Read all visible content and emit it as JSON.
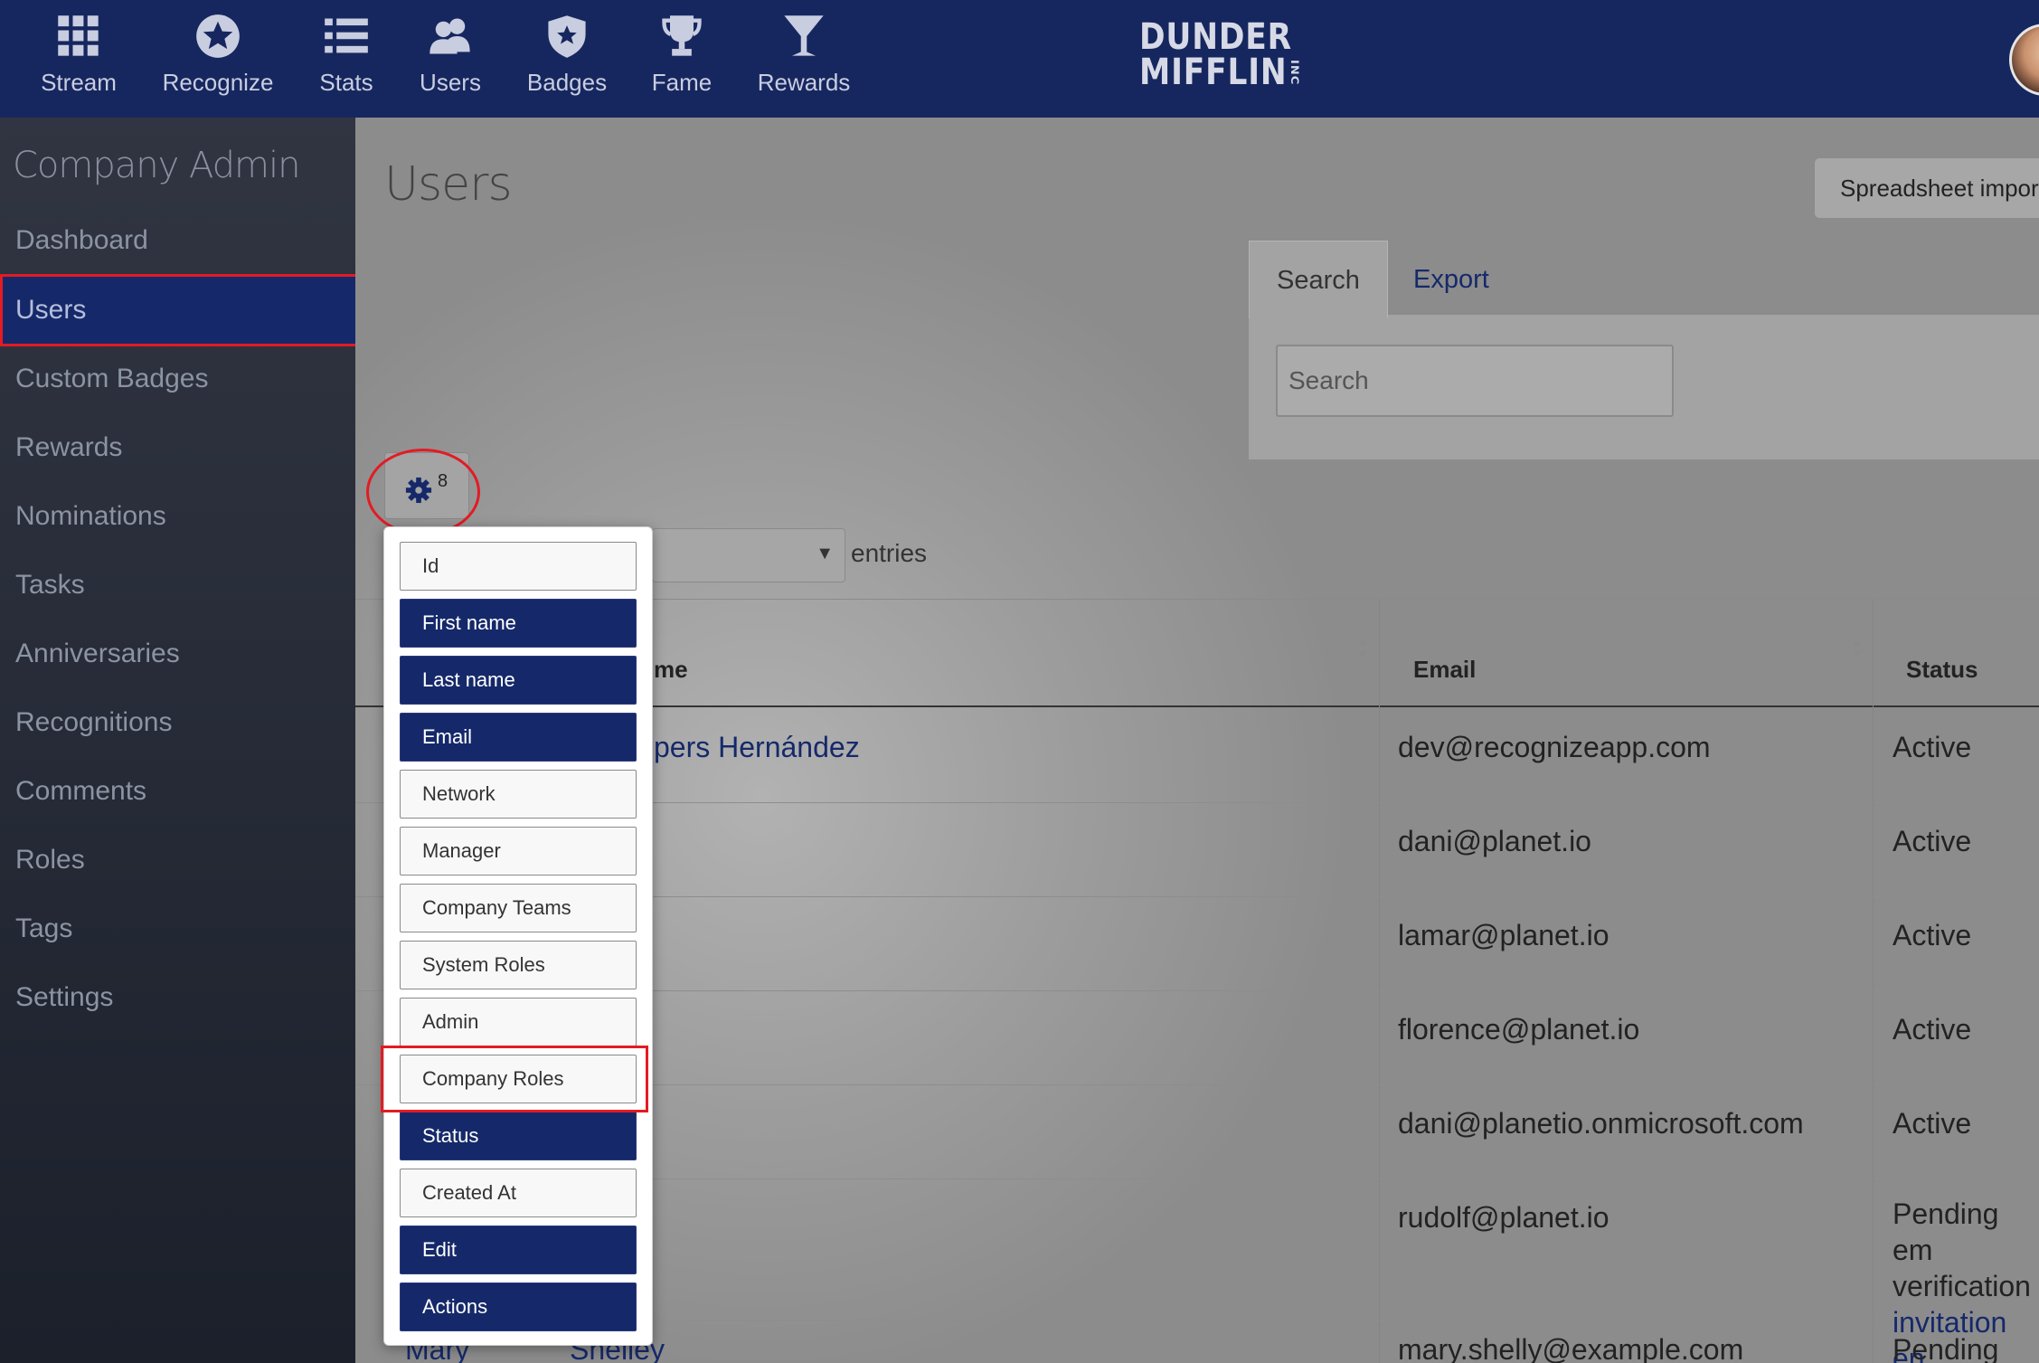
{
  "nav": {
    "items": [
      {
        "label": "Stream",
        "icon": "grid-icon"
      },
      {
        "label": "Recognize",
        "icon": "star-icon"
      },
      {
        "label": "Stats",
        "icon": "list-icon"
      },
      {
        "label": "Users",
        "icon": "users-icon"
      },
      {
        "label": "Badges",
        "icon": "shield-icon"
      },
      {
        "label": "Fame",
        "icon": "trophy-icon"
      },
      {
        "label": "Rewards",
        "icon": "cocktail-icon"
      }
    ],
    "logo_line1": "DUNDER",
    "logo_line2": "MIFFLIN",
    "logo_suffix": "INC"
  },
  "sidebar": {
    "title": "Company Admin",
    "items": [
      {
        "label": "Dashboard"
      },
      {
        "label": "Users",
        "active": true
      },
      {
        "label": "Custom Badges"
      },
      {
        "label": "Rewards"
      },
      {
        "label": "Nominations"
      },
      {
        "label": "Tasks"
      },
      {
        "label": "Anniversaries"
      },
      {
        "label": "Recognitions"
      },
      {
        "label": "Comments"
      },
      {
        "label": "Roles"
      },
      {
        "label": "Tags"
      },
      {
        "label": "Settings"
      }
    ]
  },
  "main": {
    "title": "Users",
    "spreadsheet_button": "Spreadsheet import",
    "tabs": {
      "search": "Search",
      "export": "Export"
    },
    "search_placeholder": "Search",
    "column_toggle_count": "8",
    "entries_label": "entries"
  },
  "table": {
    "headers": {
      "name": "me",
      "email": "Email",
      "status": "Status"
    },
    "rows": [
      {
        "name": "pers Hernández",
        "email": "dev@recognizeapp.com",
        "status": "Active"
      },
      {
        "name": "",
        "email": "dani@planet.io",
        "status": "Active"
      },
      {
        "name": "",
        "email": "lamar@planet.io",
        "status": "Active"
      },
      {
        "name": "",
        "email": "florence@planet.io",
        "status": "Active"
      },
      {
        "name": "",
        "email": "dani@planetio.onmicrosoft.com",
        "status": "Active"
      },
      {
        "name": "",
        "email": "rudolf@planet.io",
        "status_line1": "Pending em",
        "status_line2": "verification",
        "status_link": "invitation en"
      },
      {
        "first": "Mary",
        "last": "Shelley",
        "email": "mary.shelly@example.com",
        "status": "Pending"
      }
    ]
  },
  "column_menu": {
    "items": [
      {
        "label": "Id",
        "active": false
      },
      {
        "label": "First name",
        "active": true
      },
      {
        "label": "Last name",
        "active": true
      },
      {
        "label": "Email",
        "active": true
      },
      {
        "label": "Network",
        "active": false
      },
      {
        "label": "Manager",
        "active": false
      },
      {
        "label": "Company Teams",
        "active": false
      },
      {
        "label": "System Roles",
        "active": false
      },
      {
        "label": "Admin",
        "active": false
      },
      {
        "label": "Company Roles",
        "active": false
      },
      {
        "label": "Status",
        "active": true
      },
      {
        "label": "Created At",
        "active": false
      },
      {
        "label": "Edit",
        "active": true
      },
      {
        "label": "Actions",
        "active": true
      }
    ]
  },
  "colors": {
    "brand_navy": "#16275f",
    "highlight_red": "#e31b23"
  }
}
